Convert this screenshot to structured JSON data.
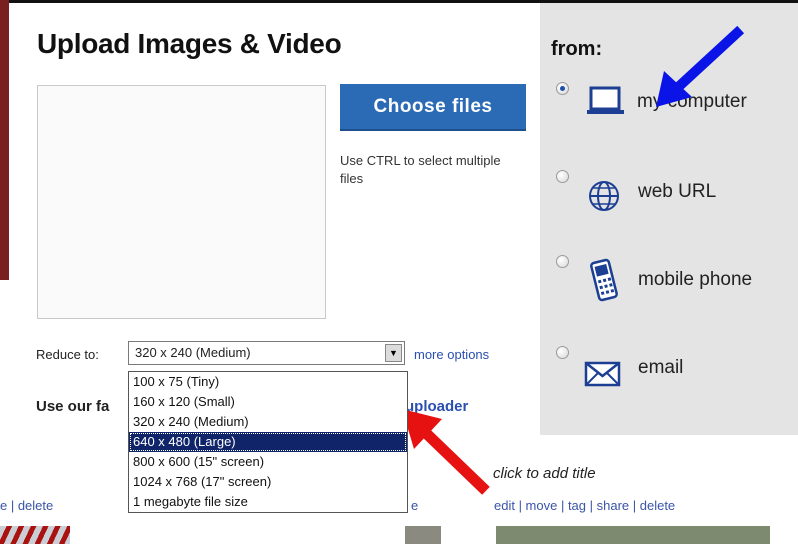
{
  "upload": {
    "title": "Upload Images & Video",
    "choose_button": "Choose files",
    "hint": "Use CTRL to select multiple files",
    "reduce_label": "Reduce to:",
    "reduce_selected": "320 x 240 (Medium)",
    "more_options": "more options",
    "promo_start": "Use our fa",
    "promo_end": "uploader",
    "size_options": [
      "100 x 75 (Tiny)",
      "160 x 120 (Small)",
      "320 x 240 (Medium)",
      "640 x 480 (Large)",
      "800 x 600 (15\" screen)",
      "1024 x 768 (17\" screen)",
      "1 megabyte file size"
    ],
    "highlighted_option": "640 x 480 (Large)"
  },
  "sources": {
    "label": "from:",
    "items": [
      {
        "label": "my computer",
        "icon": "laptop-icon",
        "checked": true
      },
      {
        "label": "web URL",
        "icon": "globe-icon",
        "checked": false
      },
      {
        "label": "mobile phone",
        "icon": "mobile-phone-icon",
        "checked": false
      },
      {
        "label": "email",
        "icon": "envelope-icon",
        "checked": false
      }
    ]
  },
  "gallery": {
    "left_actions": "e | delete",
    "partial_letter": "e",
    "add_title": "click to add title",
    "actions": "edit | move | tag | share | delete"
  },
  "annotations": {
    "arrow_blue_color": "#0a14e6",
    "arrow_red_color": "#e61212"
  }
}
